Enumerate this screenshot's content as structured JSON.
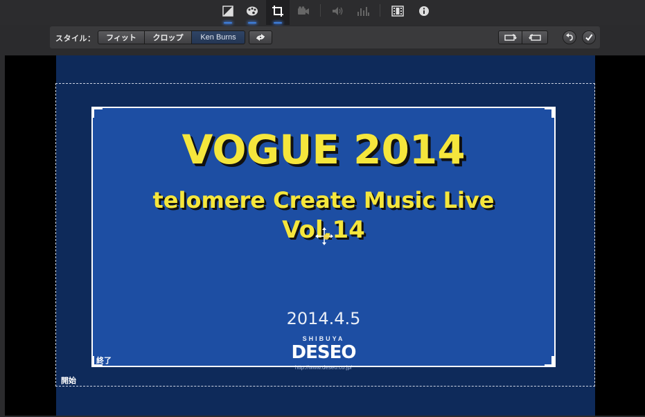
{
  "toolbar": {
    "icons": [
      "color-balance-icon",
      "color-correction-icon",
      "crop-icon",
      "stabilization-icon",
      "volume-icon",
      "noise-reduction-icon",
      "speed-icon",
      "clip-info-icon"
    ],
    "active": "crop-icon",
    "accent": "#3f7fdc"
  },
  "stylebar": {
    "label": "スタイル：",
    "options": [
      {
        "label": "フィット",
        "selected": false
      },
      {
        "label": "クロップ",
        "selected": false
      },
      {
        "label": "Ken Burns",
        "selected": true
      }
    ],
    "swap_icon": "swap-arrows-icon",
    "rotate_left_icon": "rotate-left-icon",
    "rotate_right_icon": "rotate-right-icon",
    "reset_icon": "undo-icon",
    "done_icon": "checkmark-icon"
  },
  "viewer": {
    "start_label": "開始",
    "end_label": "終了",
    "slide": {
      "title": "VOGUE 2014",
      "subtitle": "telomere Create Music Live",
      "volume": "Vol.14",
      "date": "2014.4.5",
      "logo_top": "SHIBUYA",
      "logo_main": "DESEO",
      "logo_url": "http://www.deseo.co.jp/"
    }
  }
}
